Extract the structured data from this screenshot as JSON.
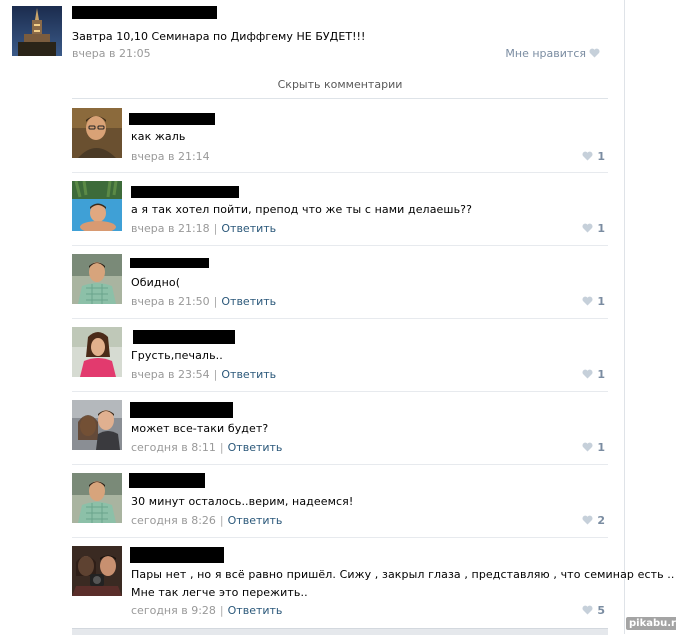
{
  "post": {
    "text": "Завтра 10,10 Семинара по Диффгему НЕ БУДЕТ!!!",
    "time": "вчера в 21:05",
    "like_label": "Мне нравится"
  },
  "hide_comments_label": "Скрыть комментарии",
  "reply_label": "Ответить",
  "comments": [
    {
      "text": "как жаль",
      "time": "вчера в 21:14",
      "likes": "1",
      "has_reply": false
    },
    {
      "text": "а я так хотел пойти, препод что же ты с нами делаешь??",
      "time": "вчера в 21:18",
      "likes": "1",
      "has_reply": true
    },
    {
      "text": "Обидно(",
      "time": "вчера в 21:50",
      "likes": "1",
      "has_reply": true
    },
    {
      "text": "Грусть,печаль..",
      "time": "вчера в 23:54",
      "likes": "1",
      "has_reply": true
    },
    {
      "text": "может все-таки будет?",
      "time": "сегодня в 8:11",
      "likes": "1",
      "has_reply": true
    },
    {
      "text": "30 минут осталось..верим, надеемся!",
      "time": "сегодня в 8:26",
      "likes": "2",
      "has_reply": true
    },
    {
      "text": "Пары нет , но я всё равно пришёл. Сижу , закрыл глаза , представляю , что семинар есть ..",
      "text2": "Мне так легче это пережить..",
      "time": "сегодня в 9:28",
      "likes": "5",
      "has_reply": true
    }
  ],
  "watermark": "pikabu.ru",
  "colors": {
    "link": "#2b587a",
    "muted": "#999999",
    "like": "#7a8ca1"
  }
}
